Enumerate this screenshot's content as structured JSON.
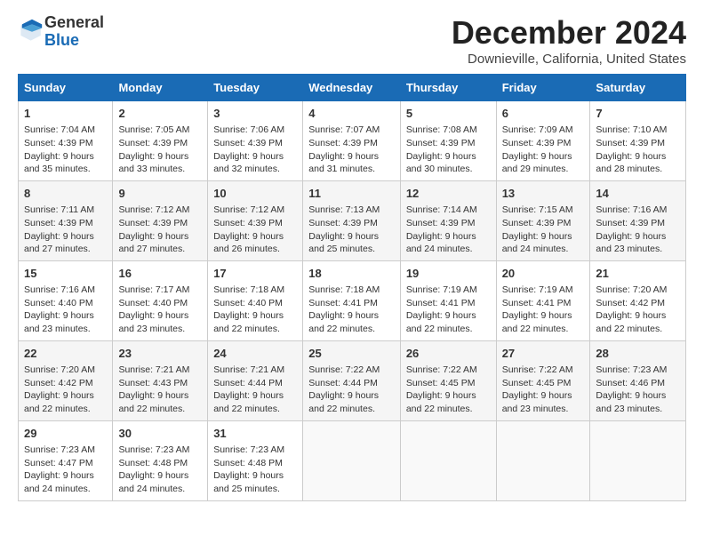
{
  "header": {
    "logo_text_general": "General",
    "logo_text_blue": "Blue",
    "month_title": "December 2024",
    "location": "Downieville, California, United States"
  },
  "columns": [
    "Sunday",
    "Monday",
    "Tuesday",
    "Wednesday",
    "Thursday",
    "Friday",
    "Saturday"
  ],
  "weeks": [
    [
      {
        "day": "1",
        "sunrise": "Sunrise: 7:04 AM",
        "sunset": "Sunset: 4:39 PM",
        "daylight": "Daylight: 9 hours and 35 minutes."
      },
      {
        "day": "2",
        "sunrise": "Sunrise: 7:05 AM",
        "sunset": "Sunset: 4:39 PM",
        "daylight": "Daylight: 9 hours and 33 minutes."
      },
      {
        "day": "3",
        "sunrise": "Sunrise: 7:06 AM",
        "sunset": "Sunset: 4:39 PM",
        "daylight": "Daylight: 9 hours and 32 minutes."
      },
      {
        "day": "4",
        "sunrise": "Sunrise: 7:07 AM",
        "sunset": "Sunset: 4:39 PM",
        "daylight": "Daylight: 9 hours and 31 minutes."
      },
      {
        "day": "5",
        "sunrise": "Sunrise: 7:08 AM",
        "sunset": "Sunset: 4:39 PM",
        "daylight": "Daylight: 9 hours and 30 minutes."
      },
      {
        "day": "6",
        "sunrise": "Sunrise: 7:09 AM",
        "sunset": "Sunset: 4:39 PM",
        "daylight": "Daylight: 9 hours and 29 minutes."
      },
      {
        "day": "7",
        "sunrise": "Sunrise: 7:10 AM",
        "sunset": "Sunset: 4:39 PM",
        "daylight": "Daylight: 9 hours and 28 minutes."
      }
    ],
    [
      {
        "day": "8",
        "sunrise": "Sunrise: 7:11 AM",
        "sunset": "Sunset: 4:39 PM",
        "daylight": "Daylight: 9 hours and 27 minutes."
      },
      {
        "day": "9",
        "sunrise": "Sunrise: 7:12 AM",
        "sunset": "Sunset: 4:39 PM",
        "daylight": "Daylight: 9 hours and 27 minutes."
      },
      {
        "day": "10",
        "sunrise": "Sunrise: 7:12 AM",
        "sunset": "Sunset: 4:39 PM",
        "daylight": "Daylight: 9 hours and 26 minutes."
      },
      {
        "day": "11",
        "sunrise": "Sunrise: 7:13 AM",
        "sunset": "Sunset: 4:39 PM",
        "daylight": "Daylight: 9 hours and 25 minutes."
      },
      {
        "day": "12",
        "sunrise": "Sunrise: 7:14 AM",
        "sunset": "Sunset: 4:39 PM",
        "daylight": "Daylight: 9 hours and 24 minutes."
      },
      {
        "day": "13",
        "sunrise": "Sunrise: 7:15 AM",
        "sunset": "Sunset: 4:39 PM",
        "daylight": "Daylight: 9 hours and 24 minutes."
      },
      {
        "day": "14",
        "sunrise": "Sunrise: 7:16 AM",
        "sunset": "Sunset: 4:39 PM",
        "daylight": "Daylight: 9 hours and 23 minutes."
      }
    ],
    [
      {
        "day": "15",
        "sunrise": "Sunrise: 7:16 AM",
        "sunset": "Sunset: 4:40 PM",
        "daylight": "Daylight: 9 hours and 23 minutes."
      },
      {
        "day": "16",
        "sunrise": "Sunrise: 7:17 AM",
        "sunset": "Sunset: 4:40 PM",
        "daylight": "Daylight: 9 hours and 23 minutes."
      },
      {
        "day": "17",
        "sunrise": "Sunrise: 7:18 AM",
        "sunset": "Sunset: 4:40 PM",
        "daylight": "Daylight: 9 hours and 22 minutes."
      },
      {
        "day": "18",
        "sunrise": "Sunrise: 7:18 AM",
        "sunset": "Sunset: 4:41 PM",
        "daylight": "Daylight: 9 hours and 22 minutes."
      },
      {
        "day": "19",
        "sunrise": "Sunrise: 7:19 AM",
        "sunset": "Sunset: 4:41 PM",
        "daylight": "Daylight: 9 hours and 22 minutes."
      },
      {
        "day": "20",
        "sunrise": "Sunrise: 7:19 AM",
        "sunset": "Sunset: 4:41 PM",
        "daylight": "Daylight: 9 hours and 22 minutes."
      },
      {
        "day": "21",
        "sunrise": "Sunrise: 7:20 AM",
        "sunset": "Sunset: 4:42 PM",
        "daylight": "Daylight: 9 hours and 22 minutes."
      }
    ],
    [
      {
        "day": "22",
        "sunrise": "Sunrise: 7:20 AM",
        "sunset": "Sunset: 4:42 PM",
        "daylight": "Daylight: 9 hours and 22 minutes."
      },
      {
        "day": "23",
        "sunrise": "Sunrise: 7:21 AM",
        "sunset": "Sunset: 4:43 PM",
        "daylight": "Daylight: 9 hours and 22 minutes."
      },
      {
        "day": "24",
        "sunrise": "Sunrise: 7:21 AM",
        "sunset": "Sunset: 4:44 PM",
        "daylight": "Daylight: 9 hours and 22 minutes."
      },
      {
        "day": "25",
        "sunrise": "Sunrise: 7:22 AM",
        "sunset": "Sunset: 4:44 PM",
        "daylight": "Daylight: 9 hours and 22 minutes."
      },
      {
        "day": "26",
        "sunrise": "Sunrise: 7:22 AM",
        "sunset": "Sunset: 4:45 PM",
        "daylight": "Daylight: 9 hours and 22 minutes."
      },
      {
        "day": "27",
        "sunrise": "Sunrise: 7:22 AM",
        "sunset": "Sunset: 4:45 PM",
        "daylight": "Daylight: 9 hours and 23 minutes."
      },
      {
        "day": "28",
        "sunrise": "Sunrise: 7:23 AM",
        "sunset": "Sunset: 4:46 PM",
        "daylight": "Daylight: 9 hours and 23 minutes."
      }
    ],
    [
      {
        "day": "29",
        "sunrise": "Sunrise: 7:23 AM",
        "sunset": "Sunset: 4:47 PM",
        "daylight": "Daylight: 9 hours and 24 minutes."
      },
      {
        "day": "30",
        "sunrise": "Sunrise: 7:23 AM",
        "sunset": "Sunset: 4:48 PM",
        "daylight": "Daylight: 9 hours and 24 minutes."
      },
      {
        "day": "31",
        "sunrise": "Sunrise: 7:23 AM",
        "sunset": "Sunset: 4:48 PM",
        "daylight": "Daylight: 9 hours and 25 minutes."
      },
      null,
      null,
      null,
      null
    ]
  ]
}
